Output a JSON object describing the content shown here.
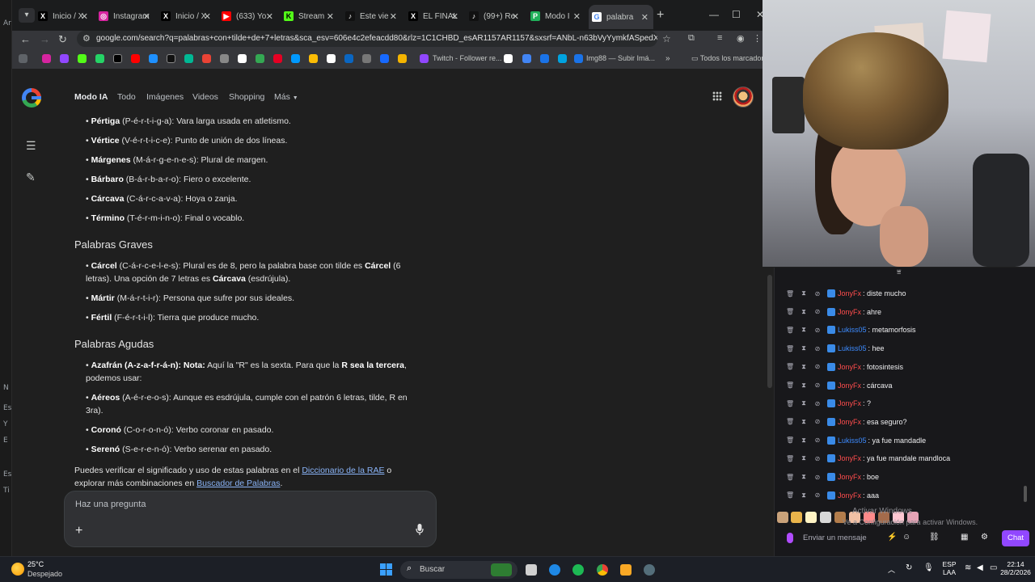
{
  "edge_strip": {
    "labels": [
      "Ar",
      "N",
      "Es",
      "Y",
      "E",
      "Es",
      "Ti"
    ]
  },
  "browser": {
    "tabs": [
      {
        "label": "Inicio / X",
        "fav": "X",
        "fav_color": "#000000",
        "fav_fg": "#ffffff"
      },
      {
        "label": "Instagram",
        "fav": "◎",
        "fav_color": "#d6249f",
        "fav_fg": "#ffffff"
      },
      {
        "label": "Inicio / X",
        "fav": "X",
        "fav_color": "#000000",
        "fav_fg": "#ffffff"
      },
      {
        "label": "(633) Yo",
        "fav": "▶",
        "fav_color": "#ff0000",
        "fav_fg": "#ffffff"
      },
      {
        "label": "Stream",
        "fav": "K",
        "fav_color": "#53fc18",
        "fav_fg": "#000000"
      },
      {
        "label": "Este vie",
        "fav": "♪",
        "fav_color": "#111111",
        "fav_fg": "#ffffff"
      },
      {
        "label": "EL FINAL",
        "fav": "X",
        "fav_color": "#000000",
        "fav_fg": "#ffffff"
      },
      {
        "label": "(99+) Re",
        "fav": "♪",
        "fav_color": "#111111",
        "fav_fg": "#ffffff"
      },
      {
        "label": "Modo I",
        "fav": "P",
        "fav_color": "#20b15a",
        "fav_fg": "#ffffff"
      },
      {
        "label": "palabra",
        "fav": "G",
        "fav_color": "#ffffff",
        "fav_fg": "#4285f4"
      }
    ],
    "url": "google.com/search?q=palabras+con+tilde+de+7+letras&sca_esv=606e4c2efeacdd80&rlz=1C1CHBD_esAR1157AR1157&sxsrf=ANbL-n63bVyYymkfASpedXffvEyHJyH...",
    "bookmarks_more_label": "Todos los marcadores",
    "bookmark_twitch": "Twitch - Follower re...",
    "bookmark_img88": "Img88 — Subir Imá..."
  },
  "google": {
    "tabs": [
      "Modo IA",
      "Todo",
      "Imágenes",
      "Videos",
      "Shopping",
      "Más"
    ],
    "sections": [
      {
        "heading": "",
        "items": [
          {
            "word": "Pértiga",
            "rest": " (P-é-r-t-i-g-a): Vara larga usada en atletismo."
          },
          {
            "word": "Vértice",
            "rest": " (V-é-r-t-i-c-e): Punto de unión de dos líneas."
          },
          {
            "word": "Márgenes",
            "rest": " (M-á-r-g-e-n-e-s): Plural de margen."
          },
          {
            "word": "Bárbaro",
            "rest": " (B-á-r-b-a-r-o): Fiero o excelente."
          },
          {
            "word": "Cárcava",
            "rest": " (C-á-r-c-a-v-a): Hoya o zanja."
          },
          {
            "word": "Término",
            "rest": " (T-é-r-m-i-n-o): Final o vocablo."
          }
        ]
      }
    ],
    "graves": {
      "heading": "Palabras Graves",
      "carcel_word": "Cárcel",
      "carcel_rest": " (C-á-r-c-e-l-e-s): Plural es de 8, pero la palabra base con tilde es ",
      "carcel_bold2": "Cárcel",
      "carcel_rest2": " (6 letras). Una opción de 7 letras es ",
      "carcel_bold3": "Cárcava",
      "carcel_rest3": " (esdrújula).",
      "martir_word": "Mártir",
      "martir_rest": " (M-á-r-t-i-r): Persona que sufre por sus ideales.",
      "fertil_word": "Fértil",
      "fertil_rest": " (F-é-r-t-i-l): Tierra que produce mucho."
    },
    "agudas": {
      "heading": "Palabras Agudas",
      "azafran_word": "Azafrán (A-z-a-f-r-á-n): Nota:",
      "azafran_rest": " Aquí la \"R\" es la sexta. Para que la ",
      "azafran_bold": "R sea la tercera",
      "azafran_rest2": ", podemos usar:",
      "aereos_word": "Aéreos",
      "aereos_rest": " (A-é-r-e-o-s): Aunque es esdrújula, cumple con el patrón 6 letras, tilde, R en 3ra).",
      "corono_word": "Coronó",
      "corono_rest": " (C-o-r-o-n-ó): Verbo coronar en pasado.",
      "sereno_word": "Serenó",
      "sereno_rest": " (S-e-r-e-n-ó): Verbo serenar en pasado."
    },
    "footer_pre": "Puedes verificar el significado y uso de estas palabras en el ",
    "footer_link1": "Diccionario de la RAE",
    "footer_mid": " o explorar más combinaciones en ",
    "footer_link2": "Buscador de Palabras",
    "footer_post": ".",
    "ask_placeholder": "Haz una pregunta"
  },
  "chat": {
    "messages": [
      {
        "user": "JonyFx",
        "color": "#ff4d4d",
        "text": ": diste mucho"
      },
      {
        "user": "JonyFx",
        "color": "#ff4d4d",
        "text": ": ahre"
      },
      {
        "user": "Lukiss05",
        "color": "#3d8bff",
        "text": ": metamorfosis"
      },
      {
        "user": "Lukiss05",
        "color": "#3d8bff",
        "text": ": hee"
      },
      {
        "user": "JonyFx",
        "color": "#ff4d4d",
        "text": ": fotosintesis"
      },
      {
        "user": "JonyFx",
        "color": "#ff4d4d",
        "text": ": cárcava"
      },
      {
        "user": "JonyFx",
        "color": "#ff4d4d",
        "text": ": ?"
      },
      {
        "user": "JonyFx",
        "color": "#ff4d4d",
        "text": ": esa seguro?"
      },
      {
        "user": "Lukiss05",
        "color": "#3d8bff",
        "text": ": ya fue mandadle"
      },
      {
        "user": "JonyFx",
        "color": "#ff4d4d",
        "text": ": ya fue mandale mandloca"
      },
      {
        "user": "JonyFx",
        "color": "#ff4d4d",
        "text": ": boe"
      },
      {
        "user": "JonyFx",
        "color": "#ff4d4d",
        "text": ": aaa"
      }
    ],
    "watermark1": "Activar Windows",
    "watermark2": "Ve a Configuración para activar Windows.",
    "input_placeholder": "Enviar un mensaje",
    "send_label": "Chat"
  },
  "taskbar": {
    "temp": "25°C",
    "weather": "Despejado",
    "search": "Buscar",
    "lang_top": "ESP",
    "lang_bottom": "LAA",
    "time": "22:14",
    "date": "28/2/2026"
  }
}
